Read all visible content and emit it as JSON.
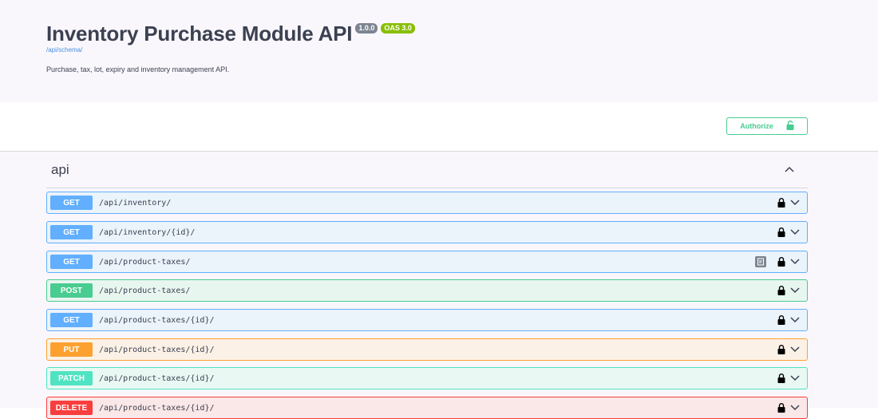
{
  "info": {
    "title": "Inventory Purchase Module API",
    "version_badge": "1.0.0",
    "oas_badge": "OAS 3.0",
    "schema_link": "/api/schema/",
    "description": "Purchase, tax, lot, expiry and inventory management API."
  },
  "scheme": {
    "authorize_label": "Authorize"
  },
  "tag": {
    "name": "api"
  },
  "colors": {
    "get": "#61affe",
    "post": "#49cc90",
    "put": "#fca130",
    "patch": "#50e3c2",
    "delete": "#f93e3e"
  },
  "operations": [
    {
      "method": "GET",
      "path": "/api/inventory/"
    },
    {
      "method": "GET",
      "path": "/api/inventory/{id}/"
    },
    {
      "method": "GET",
      "path": "/api/product-taxes/"
    },
    {
      "method": "POST",
      "path": "/api/product-taxes/"
    },
    {
      "method": "GET",
      "path": "/api/product-taxes/{id}/"
    },
    {
      "method": "PUT",
      "path": "/api/product-taxes/{id}/"
    },
    {
      "method": "PATCH",
      "path": "/api/product-taxes/{id}/"
    },
    {
      "method": "DELETE",
      "path": "/api/product-taxes/{id}/"
    }
  ]
}
